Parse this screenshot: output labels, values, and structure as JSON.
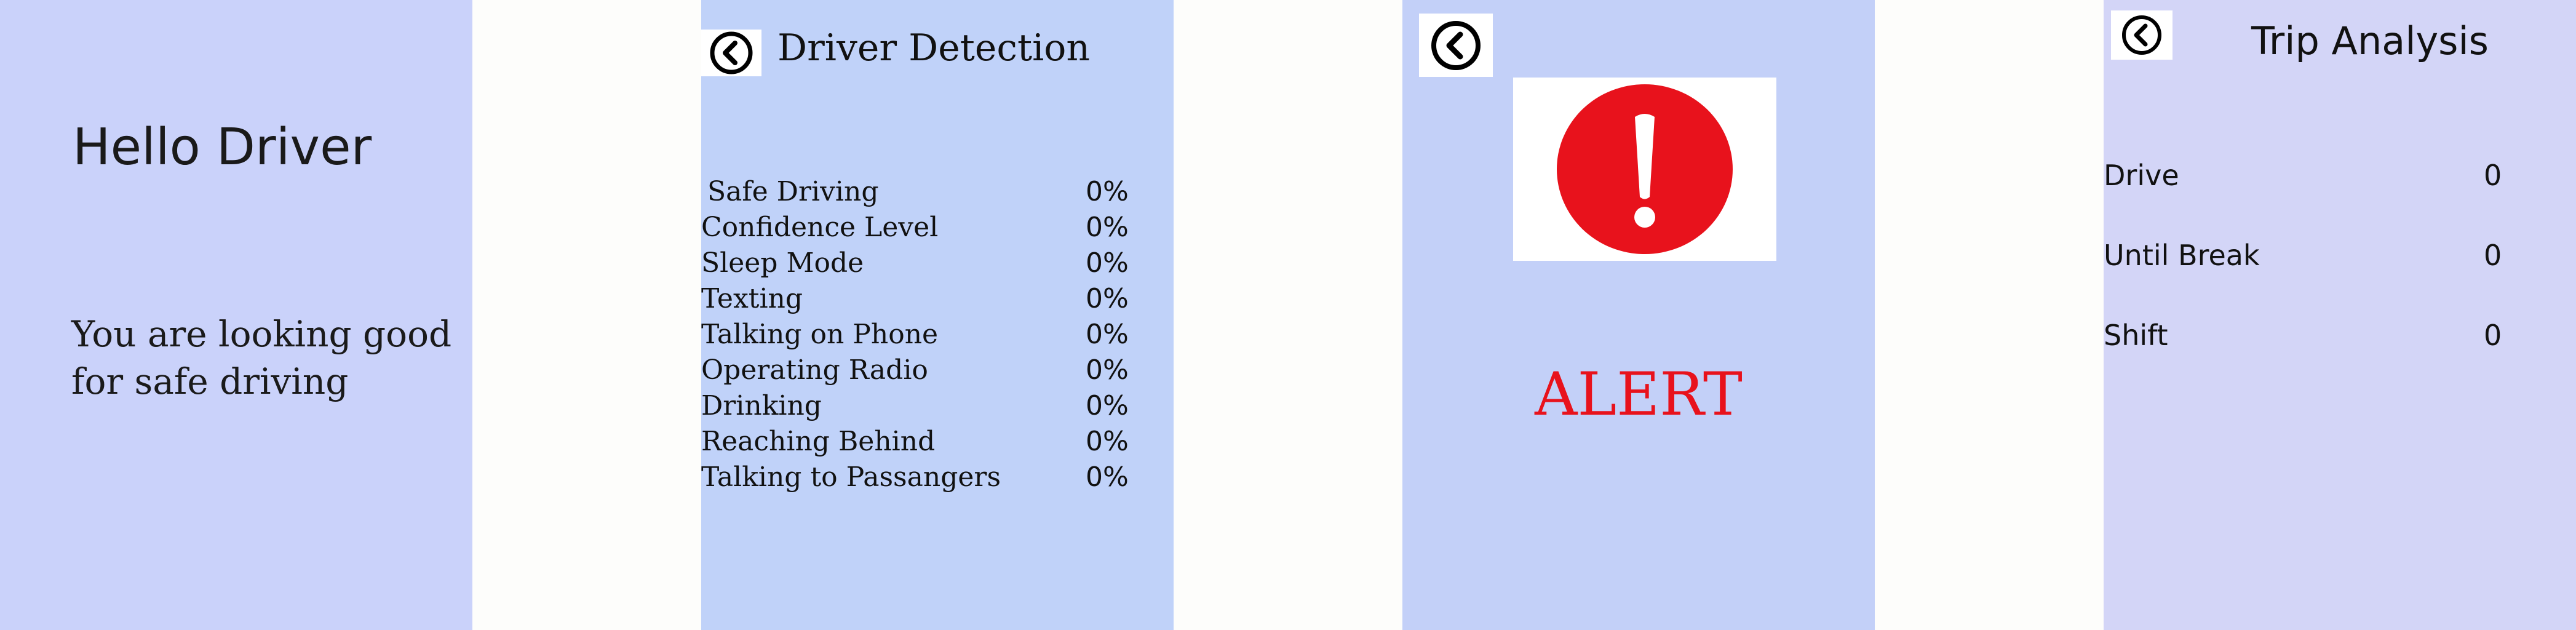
{
  "welcome": {
    "greeting": "Hello Driver",
    "message": "You are looking good for safe driving"
  },
  "detection": {
    "back_icon": "chevron-left-circle-icon",
    "title": "Driver Detection",
    "rows": [
      {
        "label": "Safe Driving",
        "value": "0%"
      },
      {
        "label": "Confidence Level",
        "value": "0%"
      },
      {
        "label": "Sleep Mode",
        "value": "0%"
      },
      {
        "label": "Texting",
        "value": "0%"
      },
      {
        "label": "Talking on Phone",
        "value": "0%"
      },
      {
        "label": "Operating Radio",
        "value": "0%"
      },
      {
        "label": "Drinking",
        "value": "0%"
      },
      {
        "label": "Reaching Behind",
        "value": "0%"
      },
      {
        "label": "Talking to Passangers",
        "value": "0%"
      }
    ]
  },
  "alert": {
    "back_icon": "chevron-left-circle-icon",
    "icon": "exclamation-circle-icon",
    "icon_color": "#e8121c",
    "text": "ALERT"
  },
  "trip": {
    "back_icon": "chevron-left-circle-icon",
    "title": "Trip Analysis",
    "rows": [
      {
        "label": "Drive",
        "value": "0"
      },
      {
        "label": "Until Break",
        "value": "0"
      },
      {
        "label": "Shift",
        "value": "0"
      }
    ]
  }
}
